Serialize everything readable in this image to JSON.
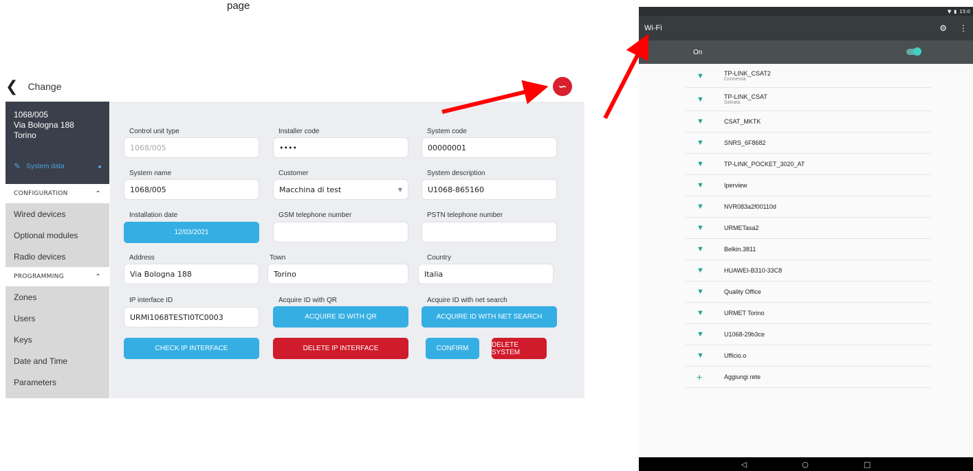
{
  "top_note": "page",
  "app": {
    "title": "Change",
    "system_id": "1068/005",
    "address_line": "Via Bologna 188",
    "city": "Torino",
    "active_item": "System data",
    "sections": [
      {
        "label": "CONFIGURATION",
        "items": [
          "Wired devices",
          "Optional modules",
          "Radio devices"
        ]
      },
      {
        "label": "PROGRAMMING",
        "items": [
          "Zones",
          "Users",
          "Keys",
          "Date and Time",
          "Parameters"
        ]
      }
    ]
  },
  "form": {
    "control_unit_type": {
      "label": "Control unit type",
      "value": "1068/005"
    },
    "installer_code": {
      "label": "Installer code",
      "value": "••••"
    },
    "system_code": {
      "label": "System code",
      "value": "00000001"
    },
    "system_name": {
      "label": "System name",
      "value": "1068/005"
    },
    "customer": {
      "label": "Customer",
      "value": "Macchina di test"
    },
    "system_description": {
      "label": "System description",
      "value": "U1068-865160"
    },
    "installation_date": {
      "label": "Installation date",
      "value": "12/03/2021"
    },
    "gsm_number": {
      "label": "GSM telephone number",
      "value": ""
    },
    "pstn_number": {
      "label": "PSTN telephone number",
      "value": ""
    },
    "address": {
      "label": "Address",
      "value": "Via Bologna 188"
    },
    "town": {
      "label": "Town",
      "value": "Torino"
    },
    "country": {
      "label": "Country",
      "value": "Italia"
    },
    "ip_interface_id": {
      "label": "IP interface ID",
      "value": "URMI1068TESTI0TC0003"
    },
    "acquire_qr": {
      "label": "Acquire ID with QR",
      "button": "ACQUIRE ID WITH QR"
    },
    "acquire_net": {
      "label": "Acquire ID with net search",
      "button": "ACQUIRE ID WITH NET SEARCH"
    },
    "buttons": {
      "check_ip": "CHECK IP INTERFACE",
      "delete_ip": "DELETE IP INTERFACE",
      "confirm": "CONFIRM",
      "delete_system": "DELETE SYSTEM"
    }
  },
  "phone": {
    "time": "15:0",
    "title": "Wi-Fi",
    "toggle_label": "On",
    "toggle_on": true,
    "networks": [
      {
        "ssid": "TP-LINK_CSAT2",
        "status": "Connessa"
      },
      {
        "ssid": "TP-LINK_CSAT",
        "status": "Salvata"
      },
      {
        "ssid": "CSAT_MKTK",
        "status": ""
      },
      {
        "ssid": "SNRS_6F8682",
        "status": ""
      },
      {
        "ssid": "TP-LINK_POCKET_3020_AT",
        "status": ""
      },
      {
        "ssid": "Iperview",
        "status": ""
      },
      {
        "ssid": "NVR083a2f00110d",
        "status": ""
      },
      {
        "ssid": "URMETasa2",
        "status": ""
      },
      {
        "ssid": "Belkin.3811",
        "status": ""
      },
      {
        "ssid": "HUAWEI-B310-33C8",
        "status": ""
      },
      {
        "ssid": "Quality Office",
        "status": ""
      },
      {
        "ssid": "URMET Torino",
        "status": ""
      },
      {
        "ssid": "U1068-29b3ce",
        "status": ""
      },
      {
        "ssid": "Ufficio.o",
        "status": ""
      }
    ],
    "add_network": "Aggiungi rete"
  },
  "colors": {
    "accent_blue": "#35aee3",
    "danger_red": "#cf1b2b",
    "annotation_red": "#ff0000",
    "wifi_green": "#21a591"
  }
}
